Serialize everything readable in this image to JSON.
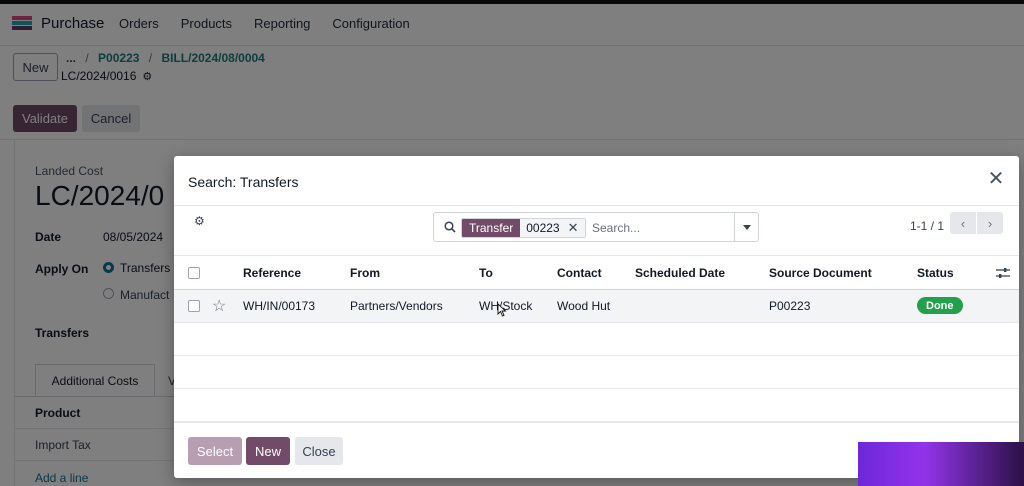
{
  "app": {
    "name": "Purchase",
    "menu": [
      "Orders",
      "Products",
      "Reporting",
      "Configuration"
    ]
  },
  "control": {
    "new_label": "New",
    "breadcrumb": [
      "...",
      "P00223",
      "BILL/2024/08/0004"
    ],
    "record": "LC/2024/0016"
  },
  "actions": {
    "validate_label": "Validate",
    "cancel_label": "Cancel"
  },
  "form": {
    "landed_cost_label": "Landed Cost",
    "title": "LC/2024/0",
    "date_label": "Date",
    "date_value": "08/05/2024",
    "apply_on_label": "Apply On",
    "apply_options": [
      "Transfers",
      "Manufact"
    ],
    "apply_selected": "Transfers",
    "transfers_label": "Transfers",
    "tabs": [
      "Additional Costs",
      "V"
    ],
    "product_header": "Product",
    "product_rows": [
      "Import Tax"
    ],
    "add_line_label": "Add a line"
  },
  "dialog": {
    "title": "Search: Transfers",
    "search": {
      "facet_key": "Transfer",
      "facet_value": "00223",
      "placeholder": "Search..."
    },
    "pager": "1-1 / 1",
    "columns": [
      "Reference",
      "From",
      "To",
      "Contact",
      "Scheduled Date",
      "Source Document",
      "Status"
    ],
    "rows": [
      {
        "reference": "WH/IN/00173",
        "from": "Partners/Vendors",
        "to": "WH/Stock",
        "contact": "Wood Hut",
        "scheduled_date": "",
        "source_document": "P00223",
        "status": "Done"
      }
    ],
    "footer": {
      "select_label": "Select",
      "new_label": "New",
      "close_label": "Close"
    }
  },
  "colors": {
    "brand": "#714b67",
    "status_done": "#22a04b",
    "link": "#1f7a7a"
  }
}
